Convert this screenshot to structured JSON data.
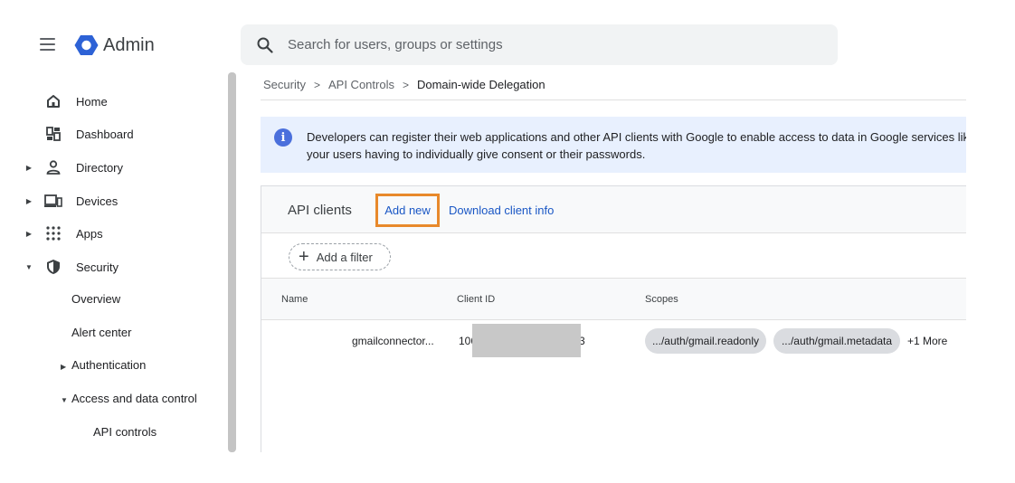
{
  "header": {
    "app_title": "Admin",
    "search_placeholder": "Search for users, groups or settings"
  },
  "sidebar": {
    "items": [
      {
        "label": "Home",
        "icon": "home-icon"
      },
      {
        "label": "Dashboard",
        "icon": "dashboard-icon"
      },
      {
        "label": "Directory",
        "icon": "person-icon"
      },
      {
        "label": "Devices",
        "icon": "devices-icon"
      },
      {
        "label": "Apps",
        "icon": "apps-grid-icon"
      },
      {
        "label": "Security",
        "icon": "shield-icon"
      }
    ],
    "security_sub": {
      "overview": "Overview",
      "alert_center": "Alert center",
      "authentication": "Authentication",
      "access_and_data_control": "Access and data control",
      "api_controls": "API controls"
    }
  },
  "breadcrumb": [
    "Security",
    "API Controls",
    "Domain-wide Delegation"
  ],
  "info_banner": {
    "line1": "Developers can register their web applications and other API clients with Google to enable access to data in Google services like Gmail. You can authorize these clients to access data without",
    "line2": "your users having to individually give consent or their passwords."
  },
  "panel": {
    "title": "API clients",
    "add_new": "Add new",
    "download": "Download client info",
    "add_filter": "Add a filter"
  },
  "table": {
    "columns": [
      "Name",
      "Client ID",
      "Scopes"
    ],
    "rows": [
      {
        "name": "gmailconnector...",
        "client_id_start": "106",
        "client_id_end": "3",
        "scopes": [
          ".../auth/gmail.readonly",
          ".../auth/gmail.metadata"
        ],
        "more": "+1 More"
      }
    ]
  },
  "colors": {
    "accent_link": "#1a57c5",
    "highlight_box": "#e8892b",
    "banner_bg": "#e8f0fe",
    "logo_blue": "#2d62d6"
  }
}
